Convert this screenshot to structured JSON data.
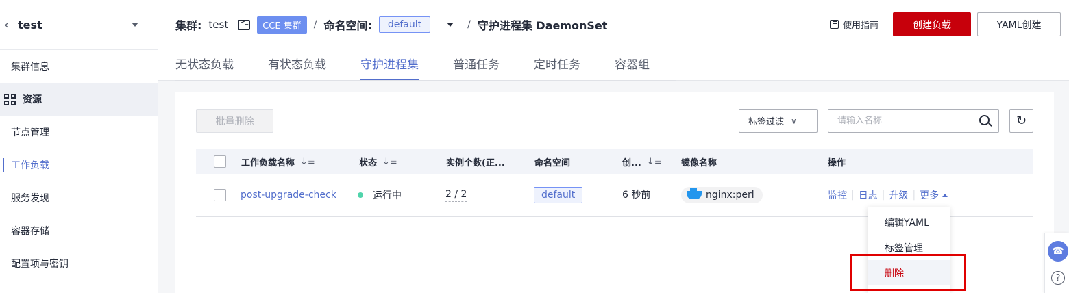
{
  "sidebar": {
    "cluster_name": "test",
    "items": [
      {
        "label": "集群信息"
      },
      {
        "label": "资源"
      },
      {
        "label": "节点管理"
      },
      {
        "label": "工作负载"
      },
      {
        "label": "服务发现"
      },
      {
        "label": "容器存储"
      },
      {
        "label": "配置项与密钥"
      }
    ]
  },
  "header": {
    "cluster_label": "集群:",
    "cluster_value": "test",
    "cluster_badge": "CCE 集群",
    "separator": "/",
    "namespace_label": "命名空间:",
    "namespace_value": "default",
    "page_title": "守护进程集 DaemonSet",
    "guide_label": "使用指南",
    "create_button": "创建负载",
    "yaml_button": "YAML创建",
    "tabs": [
      {
        "label": "无状态负载"
      },
      {
        "label": "有状态负载"
      },
      {
        "label": "守护进程集",
        "active": true
      },
      {
        "label": "普通任务"
      },
      {
        "label": "定时任务"
      },
      {
        "label": "容器组"
      }
    ]
  },
  "toolbar": {
    "batch_delete": "批量删除",
    "tag_filter": "标签过滤",
    "search_placeholder": "请输入名称"
  },
  "table": {
    "columns": [
      "工作负载名称",
      "状态",
      "实例个数(正...",
      "命名空间",
      "创...",
      "镜像名称",
      "操作"
    ],
    "rows": [
      {
        "name": "post-upgrade-check",
        "status": "运行中",
        "instances": "2 / 2",
        "namespace": "default",
        "created": "6 秒前",
        "image": "nginx:perl",
        "ops": [
          "监控",
          "日志",
          "升级",
          "更多"
        ]
      }
    ]
  },
  "dropdown": {
    "items": [
      "编辑YAML",
      "标签管理",
      "删除"
    ]
  },
  "colors": {
    "brand_red": "#c7000b",
    "accent_blue": "#526ecc",
    "status_green": "#50d4ab",
    "highlight_red": "#e00000"
  }
}
